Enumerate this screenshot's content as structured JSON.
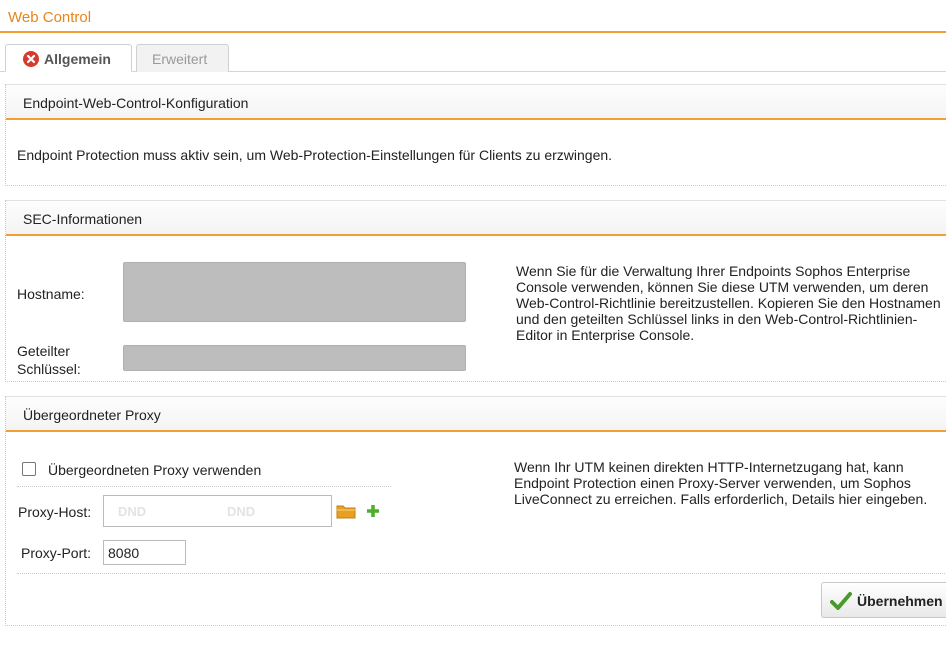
{
  "window": {
    "title": "Web Control"
  },
  "tabs": [
    {
      "label": "Allgemein",
      "active": true,
      "icon": "x-circle-icon"
    },
    {
      "label": "Erweitert",
      "active": false
    }
  ],
  "sections": {
    "endpoint": {
      "title": "Endpoint-Web-Control-Konfiguration",
      "info": "Endpoint Protection muss aktiv sein, um Web-Protection-Einstellungen für Clients zu erzwingen."
    },
    "sec": {
      "title": "SEC-Informationen",
      "hostname_label": "Hostname:",
      "shared_key_label_line1": "Geteilter",
      "shared_key_label_line2": "Schlüssel:",
      "description": "Wenn Sie für die Verwaltung Ihrer Endpoints Sophos Enterprise Console verwenden, können Sie diese UTM verwenden, um deren Web-Control-Richtlinie bereitzustellen. Kopieren Sie den Hostnamen und den geteilten Schlüssel links in den Web-Control-Richtlinien-Editor in Enterprise Console."
    },
    "proxy": {
      "title": "Übergeordneter Proxy",
      "checkbox_label": "Übergeordneten Proxy verwenden",
      "checkbox_checked": false,
      "host_label": "Proxy-Host:",
      "host_placeholder_1": "DND",
      "host_placeholder_2": "DND",
      "port_label": "Proxy-Port:",
      "port_value": "8080",
      "description": "Wenn Ihr UTM keinen direkten HTTP-Internetzugang hat, kann Endpoint Protection einen Proxy-Server verwenden, um Sophos LiveConnect zu erreichen. Falls erforderlich, Details hier eingeben.",
      "apply_label": "Übernehmen"
    }
  },
  "colors": {
    "accent": "#f0a032",
    "title": "#e8851a",
    "apply_check": "#4a9a2a",
    "add_icon": "#4caf2a",
    "folder_icon": "#e8a020",
    "close_icon": "#d63b2f"
  }
}
